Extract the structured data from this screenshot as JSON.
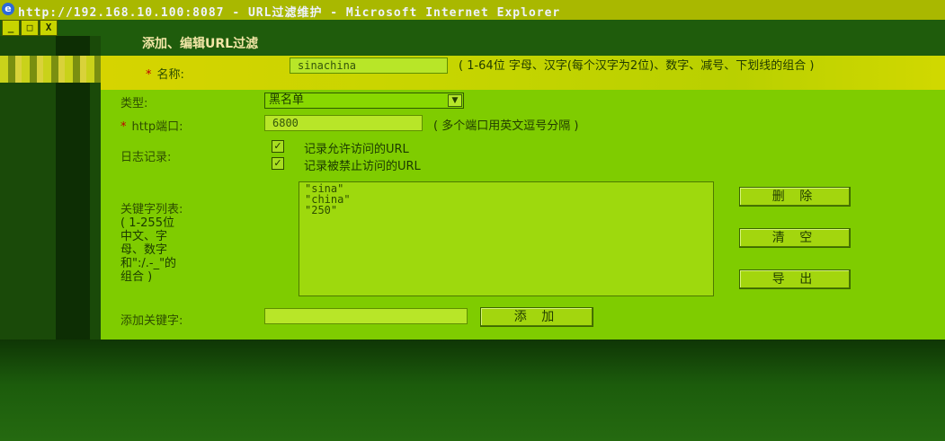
{
  "window": {
    "title": "http://192.168.10.100:8087 - URL过滤维护 - Microsoft Internet Explorer",
    "controls": [
      "_",
      "□",
      "X"
    ]
  },
  "panel": {
    "title": "添加、编辑URL过滤"
  },
  "form": {
    "name": {
      "label": "名称:",
      "value": "sinachina",
      "hint": "( 1-64位 字母、汉字(每个汉字为2位)、数字、减号、下划线的组合 )"
    },
    "type": {
      "label": "类型:",
      "selected": "黑名单"
    },
    "http_port": {
      "label": "http端口:",
      "value": "6800",
      "hint": "( 多个端口用英文逗号分隔 )"
    },
    "log": {
      "label": "日志记录:",
      "options": [
        {
          "label": "记录允许访问的URL",
          "checked": true
        },
        {
          "label": "记录被禁止访问的URL",
          "checked": true
        }
      ]
    },
    "keywords": {
      "label": "关键字列表:",
      "hint_lines": [
        "( 1-255位",
        "中文、字",
        "母、数字",
        "和\":/.-_\"的",
        "组合 )"
      ],
      "items": [
        "\"sina\"",
        "\"china\"",
        "\"250\""
      ]
    },
    "buttons": {
      "delete": "删 除",
      "clear": "清 空",
      "export": "导 出"
    },
    "add_keyword": {
      "label": "添加关键字:",
      "value": "",
      "button": "添 加"
    }
  },
  "colors": {
    "panel_bg": "#7fcc00",
    "header_bg": "#1f5c0c",
    "required": "#c00000"
  },
  "icons": {
    "browser": "internet-explorer-icon",
    "dropdown": "chevron-down-icon",
    "check": "checkmark-icon"
  }
}
